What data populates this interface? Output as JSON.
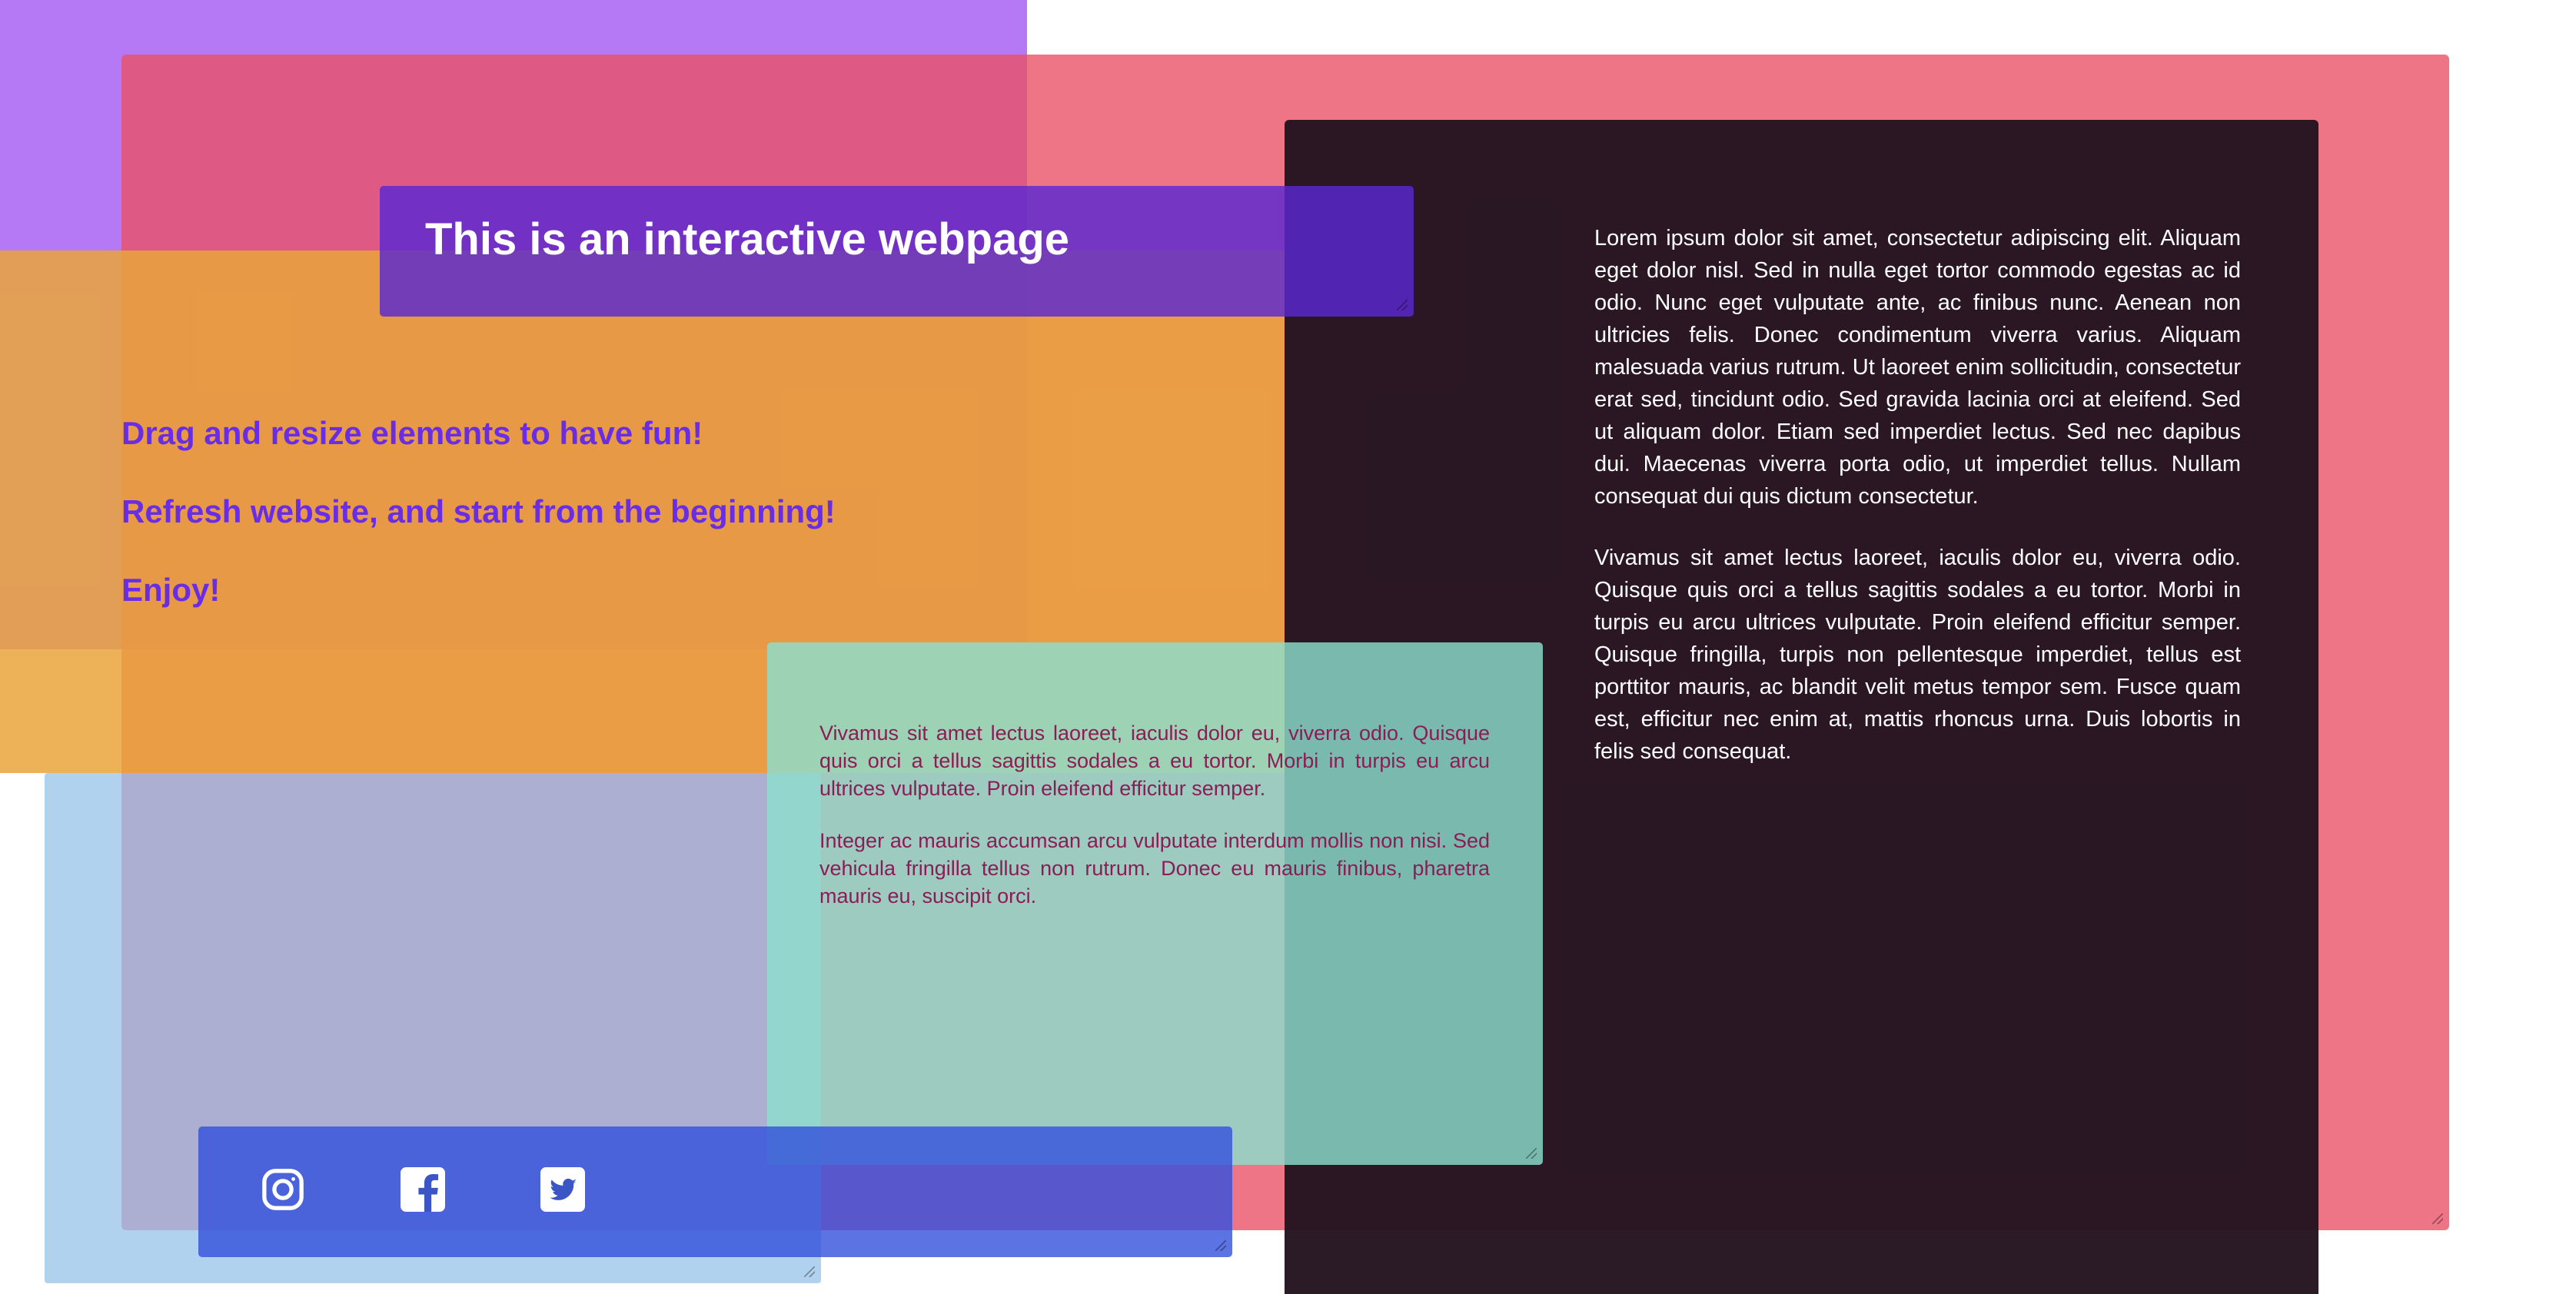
{
  "page": {
    "title": "This is an interactive webpage",
    "taglines": [
      "Drag and resize elements to have fun!",
      "Refresh website, and start from the beginning!",
      "Enjoy!"
    ]
  },
  "dark_panel": {
    "paragraphs": [
      "Lorem ipsum dolor sit amet, consectetur adipiscing elit. Aliquam eget dolor nisl. Sed in nulla eget tortor commodo egestas ac id odio. Nunc eget vulputate ante, ac finibus nunc. Aenean non ultricies felis. Donec condimentum viverra varius. Aliquam malesuada varius rutrum. Ut laoreet enim sollicitudin, consectetur erat sed, tincidunt odio. Sed gravida lacinia orci at eleifend. Sed ut aliquam dolor. Etiam sed imperdiet lectus. Sed nec dapibus dui. Maecenas viverra porta odio, ut imperdiet tellus. Nullam consequat dui quis dictum consectetur.",
      "Vivamus sit amet lectus laoreet, iaculis dolor eu, viverra odio. Quisque quis orci a tellus sagittis sodales a eu tortor. Morbi in turpis eu arcu ultrices vulputate. Proin eleifend efficitur semper. Quisque fringilla, turpis non pellentesque imperdiet, tellus est porttitor mauris, ac blandit velit metus tempor sem. Fusce quam est, efficitur nec enim at, mattis rhoncus urna. Duis lobortis in felis sed consequat."
    ]
  },
  "teal_panel": {
    "paragraphs": [
      "Vivamus sit amet lectus laoreet, iaculis dolor eu, viverra odio. Quisque quis orci a tellus sagittis sodales a eu tortor. Morbi in turpis eu arcu ultrices vulputate. Proin eleifend efficitur semper.",
      "Integer ac mauris accumsan arcu vulputate interdum mollis non nisi. Sed vehicula fringilla tellus non rutrum. Donec eu mauris finibus, pharetra mauris eu, suscipit orci."
    ]
  },
  "social": {
    "icons": [
      "instagram-icon",
      "facebook-icon",
      "twitter-icon"
    ]
  },
  "colors": {
    "violet": "#a55cf4",
    "pink": "#e85268",
    "orange": "#eaa53a",
    "light_blue": "#96c3ea",
    "dark": "#231420",
    "title_purple": "#5a28d2",
    "tagline_purple": "#6a2de6",
    "teal": "#8cdecd",
    "teal_text": "#8a1d56",
    "social_blue": "#3250dc"
  }
}
